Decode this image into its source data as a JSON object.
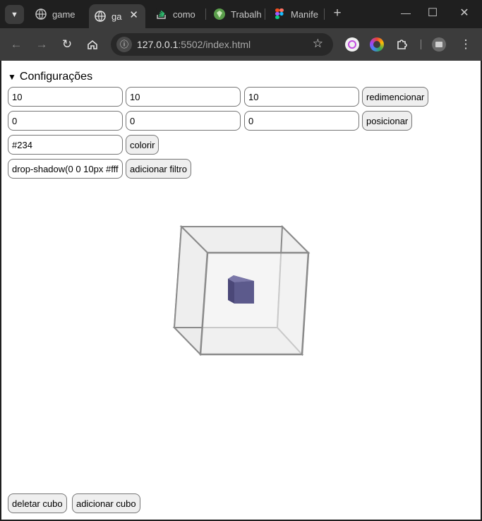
{
  "browser": {
    "tabs": [
      {
        "title": "game",
        "icon": "globe-icon"
      },
      {
        "title": "ga",
        "icon": "globe-icon"
      },
      {
        "title": "como c",
        "icon": "stackoverflow-icon"
      },
      {
        "title": "Trabalh",
        "icon": "green-logo-icon"
      },
      {
        "title": "Manife",
        "icon": "figma-icon"
      }
    ],
    "new_tab": "+",
    "url_host": "127.0.0.1",
    "url_path": ":5502/index.html"
  },
  "page": {
    "details_summary": "Configurações",
    "size": {
      "x": "10",
      "y": "10",
      "z": "10",
      "button": "redimencionar"
    },
    "position": {
      "x": "0",
      "y": "0",
      "z": "0",
      "button": "posicionar"
    },
    "color": {
      "value": "#234",
      "button": "colorir"
    },
    "filter": {
      "value": "drop-shadow(0 0 10px #fff",
      "button": "adicionar filtro"
    },
    "footer": {
      "delete": "deletar cubo",
      "add": "adicionar cubo"
    }
  },
  "colors": {
    "cube_fill": "#5c5a8c",
    "frame": "#8a8a8a"
  }
}
